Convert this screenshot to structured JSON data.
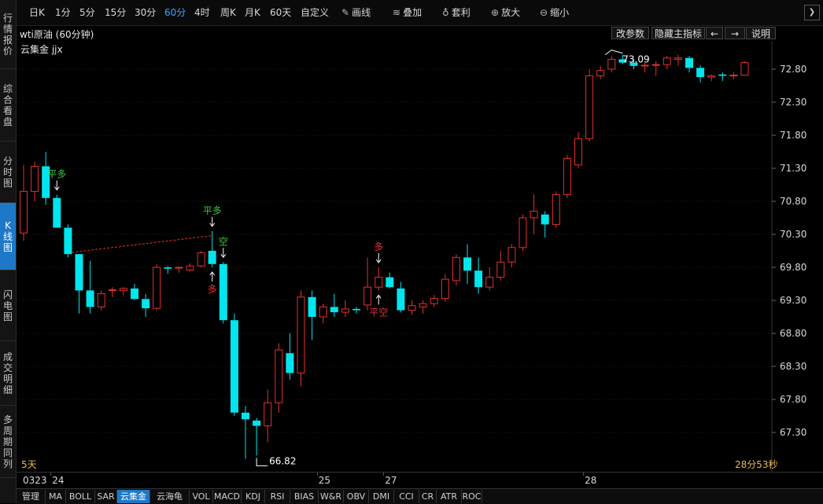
{
  "sidebar": {
    "tabs": [
      {
        "label": "行情报价",
        "active": false
      },
      {
        "label": "综合看盘",
        "active": false
      },
      {
        "label": "分时图",
        "active": false
      },
      {
        "label": "K线图",
        "active": true
      },
      {
        "label": "闪电图",
        "active": false
      },
      {
        "label": "成交明细",
        "active": false
      },
      {
        "label": "多周期同列",
        "active": false
      }
    ]
  },
  "toolbar": {
    "periods": [
      {
        "label": "日K",
        "active": false
      },
      {
        "label": "1分",
        "active": false
      },
      {
        "label": "5分",
        "active": false
      },
      {
        "label": "15分",
        "active": false
      },
      {
        "label": "30分",
        "active": false
      },
      {
        "label": "60分",
        "active": true
      },
      {
        "label": "4时",
        "active": false
      },
      {
        "label": "周K",
        "active": false
      },
      {
        "label": "月K",
        "active": false
      },
      {
        "label": "60天",
        "active": false
      },
      {
        "label": "自定义",
        "active": false
      }
    ],
    "tools": [
      {
        "label": "画线",
        "icon": "pencil-icon"
      },
      {
        "label": "叠加",
        "icon": "stack-icon"
      },
      {
        "label": "套利",
        "icon": "money-bag-icon"
      },
      {
        "label": "放大",
        "icon": "zoom-in-icon"
      },
      {
        "label": "缩小",
        "icon": "zoom-out-icon"
      }
    ]
  },
  "info": {
    "symbol": "wti原油 (60分钟)",
    "buttons": {
      "params": "改参数",
      "hide_indicator": "隐藏主指标",
      "prev": "←",
      "next": "→",
      "help": "说明"
    }
  },
  "indicator_label": "云集金 jjx",
  "period_label": "5天",
  "countdown": "28分53秒",
  "chart_data": {
    "type": "candlestick",
    "ylim": [
      66.8,
      73.1
    ],
    "y_ticks": [
      "72.80",
      "72.30",
      "71.80",
      "71.30",
      "70.80",
      "70.30",
      "69.80",
      "69.30",
      "68.80",
      "68.30",
      "67.80",
      "67.30"
    ],
    "up_color": "#e53030",
    "down_color": "#00e5ee",
    "candles": [
      {
        "o": 70.32,
        "h": 71.35,
        "l": 70.2,
        "c": 70.95
      },
      {
        "o": 70.95,
        "h": 71.4,
        "l": 70.8,
        "c": 71.33
      },
      {
        "o": 71.33,
        "h": 71.55,
        "l": 70.75,
        "c": 70.85
      },
      {
        "o": 70.85,
        "h": 70.9,
        "l": 70.4,
        "c": 70.4
      },
      {
        "o": 70.4,
        "h": 70.45,
        "l": 69.95,
        "c": 70.0
      },
      {
        "o": 70.0,
        "h": 70.0,
        "l": 69.1,
        "c": 69.45
      },
      {
        "o": 69.45,
        "h": 69.9,
        "l": 69.1,
        "c": 69.2
      },
      {
        "o": 69.2,
        "h": 69.45,
        "l": 69.15,
        "c": 69.4
      },
      {
        "o": 69.45,
        "h": 69.5,
        "l": 69.35,
        "c": 69.46
      },
      {
        "o": 69.45,
        "h": 69.5,
        "l": 69.38,
        "c": 69.48
      },
      {
        "o": 69.48,
        "h": 69.55,
        "l": 69.3,
        "c": 69.32
      },
      {
        "o": 69.32,
        "h": 69.4,
        "l": 69.05,
        "c": 69.18
      },
      {
        "o": 69.18,
        "h": 69.85,
        "l": 69.15,
        "c": 69.8
      },
      {
        "o": 69.8,
        "h": 69.82,
        "l": 69.7,
        "c": 69.78
      },
      {
        "o": 69.79,
        "h": 69.81,
        "l": 69.72,
        "c": 69.8
      },
      {
        "o": 69.76,
        "h": 69.86,
        "l": 69.74,
        "c": 69.82
      },
      {
        "o": 69.82,
        "h": 70.05,
        "l": 69.8,
        "c": 70.02
      },
      {
        "o": 70.05,
        "h": 70.35,
        "l": 69.8,
        "c": 69.85
      },
      {
        "o": 69.85,
        "h": 69.88,
        "l": 68.95,
        "c": 69.0
      },
      {
        "o": 69.0,
        "h": 69.1,
        "l": 67.55,
        "c": 67.6
      },
      {
        "o": 67.6,
        "h": 67.7,
        "l": 66.9,
        "c": 67.5
      },
      {
        "o": 67.48,
        "h": 67.52,
        "l": 66.95,
        "c": 67.4
      },
      {
        "o": 67.4,
        "h": 67.95,
        "l": 67.15,
        "c": 67.75
      },
      {
        "o": 67.75,
        "h": 68.65,
        "l": 67.6,
        "c": 68.55
      },
      {
        "o": 68.5,
        "h": 68.8,
        "l": 68.1,
        "c": 68.2
      },
      {
        "o": 68.2,
        "h": 69.45,
        "l": 68.0,
        "c": 69.35
      },
      {
        "o": 69.35,
        "h": 69.45,
        "l": 68.7,
        "c": 69.05
      },
      {
        "o": 69.05,
        "h": 69.25,
        "l": 68.95,
        "c": 69.2
      },
      {
        "o": 69.2,
        "h": 69.4,
        "l": 69.05,
        "c": 69.12
      },
      {
        "o": 69.12,
        "h": 69.3,
        "l": 69.05,
        "c": 69.17
      },
      {
        "o": 69.17,
        "h": 69.2,
        "l": 69.1,
        "c": 69.15
      },
      {
        "o": 69.23,
        "h": 69.95,
        "l": 69.15,
        "c": 69.5
      },
      {
        "o": 69.5,
        "h": 69.8,
        "l": 69.45,
        "c": 69.65
      },
      {
        "o": 69.65,
        "h": 69.72,
        "l": 69.48,
        "c": 69.5
      },
      {
        "o": 69.48,
        "h": 69.58,
        "l": 69.12,
        "c": 69.15
      },
      {
        "o": 69.15,
        "h": 69.3,
        "l": 69.08,
        "c": 69.22
      },
      {
        "o": 69.2,
        "h": 69.3,
        "l": 69.1,
        "c": 69.25
      },
      {
        "o": 69.25,
        "h": 69.38,
        "l": 69.2,
        "c": 69.33
      },
      {
        "o": 69.33,
        "h": 69.7,
        "l": 69.28,
        "c": 69.62
      },
      {
        "o": 69.6,
        "h": 70.0,
        "l": 69.52,
        "c": 69.95
      },
      {
        "o": 69.95,
        "h": 70.15,
        "l": 69.55,
        "c": 69.75
      },
      {
        "o": 69.75,
        "h": 69.95,
        "l": 69.4,
        "c": 69.5
      },
      {
        "o": 69.5,
        "h": 69.8,
        "l": 69.45,
        "c": 69.65
      },
      {
        "o": 69.65,
        "h": 70.05,
        "l": 69.6,
        "c": 69.88
      },
      {
        "o": 69.88,
        "h": 70.15,
        "l": 69.8,
        "c": 70.1
      },
      {
        "o": 70.1,
        "h": 70.6,
        "l": 70.05,
        "c": 70.55
      },
      {
        "o": 70.55,
        "h": 70.9,
        "l": 70.3,
        "c": 70.65
      },
      {
        "o": 70.6,
        "h": 70.65,
        "l": 70.25,
        "c": 70.45
      },
      {
        "o": 70.45,
        "h": 70.95,
        "l": 70.4,
        "c": 70.9
      },
      {
        "o": 70.9,
        "h": 71.5,
        "l": 70.85,
        "c": 71.45
      },
      {
        "o": 71.35,
        "h": 71.85,
        "l": 71.3,
        "c": 71.75
      },
      {
        "o": 71.75,
        "h": 72.8,
        "l": 71.7,
        "c": 72.7
      },
      {
        "o": 72.7,
        "h": 72.85,
        "l": 72.65,
        "c": 72.78
      },
      {
        "o": 72.8,
        "h": 73.0,
        "l": 72.75,
        "c": 72.95
      },
      {
        "o": 72.95,
        "h": 73.02,
        "l": 72.88,
        "c": 72.9
      },
      {
        "o": 72.9,
        "h": 72.95,
        "l": 72.8,
        "c": 72.85
      },
      {
        "o": 72.85,
        "h": 72.9,
        "l": 72.75,
        "c": 72.86
      },
      {
        "o": 72.86,
        "h": 72.92,
        "l": 72.7,
        "c": 72.87
      },
      {
        "o": 72.87,
        "h": 73.0,
        "l": 72.8,
        "c": 72.97
      },
      {
        "o": 72.95,
        "h": 73.02,
        "l": 72.85,
        "c": 72.97
      },
      {
        "o": 72.97,
        "h": 73.0,
        "l": 72.75,
        "c": 72.82
      },
      {
        "o": 72.82,
        "h": 72.86,
        "l": 72.6,
        "c": 72.68
      },
      {
        "o": 72.68,
        "h": 72.72,
        "l": 72.62,
        "c": 72.7
      },
      {
        "o": 72.72,
        "h": 72.75,
        "l": 72.62,
        "c": 72.7
      },
      {
        "o": 72.7,
        "h": 72.76,
        "l": 72.65,
        "c": 72.71
      },
      {
        "o": 72.71,
        "h": 72.92,
        "l": 72.7,
        "c": 72.9
      }
    ],
    "annotations": [
      {
        "text": "平多",
        "color": "#3ec83e",
        "candle": 3,
        "position": "above",
        "arrow": "down"
      },
      {
        "text": "平多",
        "color": "#3ec83e",
        "candle": 17,
        "position": "above",
        "arrow": "down"
      },
      {
        "text": "多",
        "color": "#e53030",
        "candle": 17,
        "position": "below",
        "arrow": "up"
      },
      {
        "text": "空",
        "color": "#3ec83e",
        "candle": 18,
        "position": "above",
        "arrow": "down"
      },
      {
        "text": "多",
        "color": "#e53030",
        "candle": 32,
        "position": "above",
        "arrow": "down"
      },
      {
        "text": "平空",
        "color": "#e53030",
        "candle": 32,
        "position": "below",
        "arrow": "up"
      }
    ],
    "high_label": "73.09",
    "low_label": "66.82",
    "x_labels": [
      {
        "text": "0323",
        "candle": 0
      },
      {
        "text": "24",
        "candle": 3
      },
      {
        "text": "25",
        "candle": 27
      },
      {
        "text": "27",
        "candle": 33
      },
      {
        "text": "28",
        "candle": 51
      }
    ]
  },
  "bottom_tabs": [
    {
      "label": "管理",
      "active": false
    },
    {
      "label": "MA",
      "active": false
    },
    {
      "label": "BOLL",
      "active": false
    },
    {
      "label": "SAR",
      "active": false
    },
    {
      "label": "云集金",
      "active": true
    },
    {
      "label": "云海龟",
      "active": false
    },
    {
      "label": "VOL",
      "active": false
    },
    {
      "label": "MACD",
      "active": false
    },
    {
      "label": "KDJ",
      "active": false
    },
    {
      "label": "RSI",
      "active": false
    },
    {
      "label": "BIAS",
      "active": false
    },
    {
      "label": "W&R",
      "active": false
    },
    {
      "label": "OBV",
      "active": false
    },
    {
      "label": "DMI",
      "active": false
    },
    {
      "label": "CCI",
      "active": false
    },
    {
      "label": "CR",
      "active": false
    },
    {
      "label": "ATR",
      "active": false
    },
    {
      "label": "ROC",
      "active": false
    }
  ]
}
